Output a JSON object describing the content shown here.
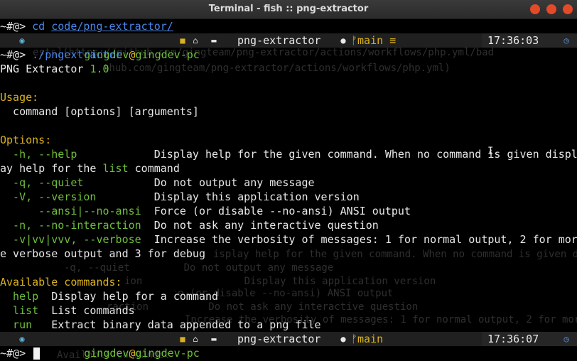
{
  "window": {
    "title": "Terminal - fish :: png-extractor"
  },
  "ghost_lines": [
    "w.sh/vn?heart",
    "ests](https://github.com/gingteam/png-extractor/actions/workflows/php.yml/bad",
    "thub.com/gingteam/png-extractor/actions/workflows/php.yml)",
    "isplay help for the given command. When no command is given display",
    "-q, --quiet         Do not output any message",
    "ion                 Display this application version",
    "e (or disable --no-ansi) ANSI output",
    "raction          Do not ask any interactive question",
    "Increase the verbosity of messages: 1 for normal output, 2 for more",
    "Available commands:"
  ],
  "line1": {
    "prompt": "~#@>",
    "cmd": "cd",
    "arg": "code/png-extractor/"
  },
  "prompt_bar_1": {
    "user": "gingdev",
    "at": "@",
    "host": "gingdev-pc",
    "dir": "png-extractor",
    "branch": "main",
    "git_icon": "≡",
    "time": "17:36:03"
  },
  "line3": {
    "prompt": "~#@>",
    "cmd": "./pngextractor"
  },
  "app": {
    "name": "PNG Extractor",
    "version": "1.0"
  },
  "usage": {
    "header": "Usage:",
    "text": "  command [options] [arguments]"
  },
  "options": {
    "header": "Options:",
    "rows": [
      {
        "flag": "  -h, --help           ",
        "desc": " Display help for the given command. When no command is given displ"
      },
      {
        "flag": "",
        "desc": ""
      },
      {
        "flag": "  -q, --quiet          ",
        "desc": " Do not output any message"
      },
      {
        "flag": "  -V, --version        ",
        "desc": " Display this application version"
      },
      {
        "flag": "      --ansi|--no-ansi ",
        "desc": " Force (or disable --no-ansi) ANSI output"
      },
      {
        "flag": "  -n, --no-interaction ",
        "desc": " Do not ask any interactive question"
      },
      {
        "flag": "  -v|vv|vvv, --verbose ",
        "desc": " Increase the verbosity of messages: 1 for normal output, 2 for more"
      }
    ],
    "help_wrap_pre": "ay help for the ",
    "help_wrap_kw": "list",
    "help_wrap_post": " command",
    "verbose_wrap": "e verbose output and 3 for debug"
  },
  "commands": {
    "header": "Available commands:",
    "rows": [
      {
        "name": "  help",
        "desc": "  Display help for a command"
      },
      {
        "name": "  list",
        "desc": "  List commands"
      },
      {
        "name": "  run ",
        "desc": "  Extract binary data appended to a png file"
      }
    ]
  },
  "prompt_bar_2": {
    "user": "gingdev",
    "at": "@",
    "host": "gingdev-pc",
    "dir": "png-extractor",
    "branch": "main",
    "git_icon": "≡",
    "time": "17:36:07"
  },
  "last_prompt": "~#@>"
}
